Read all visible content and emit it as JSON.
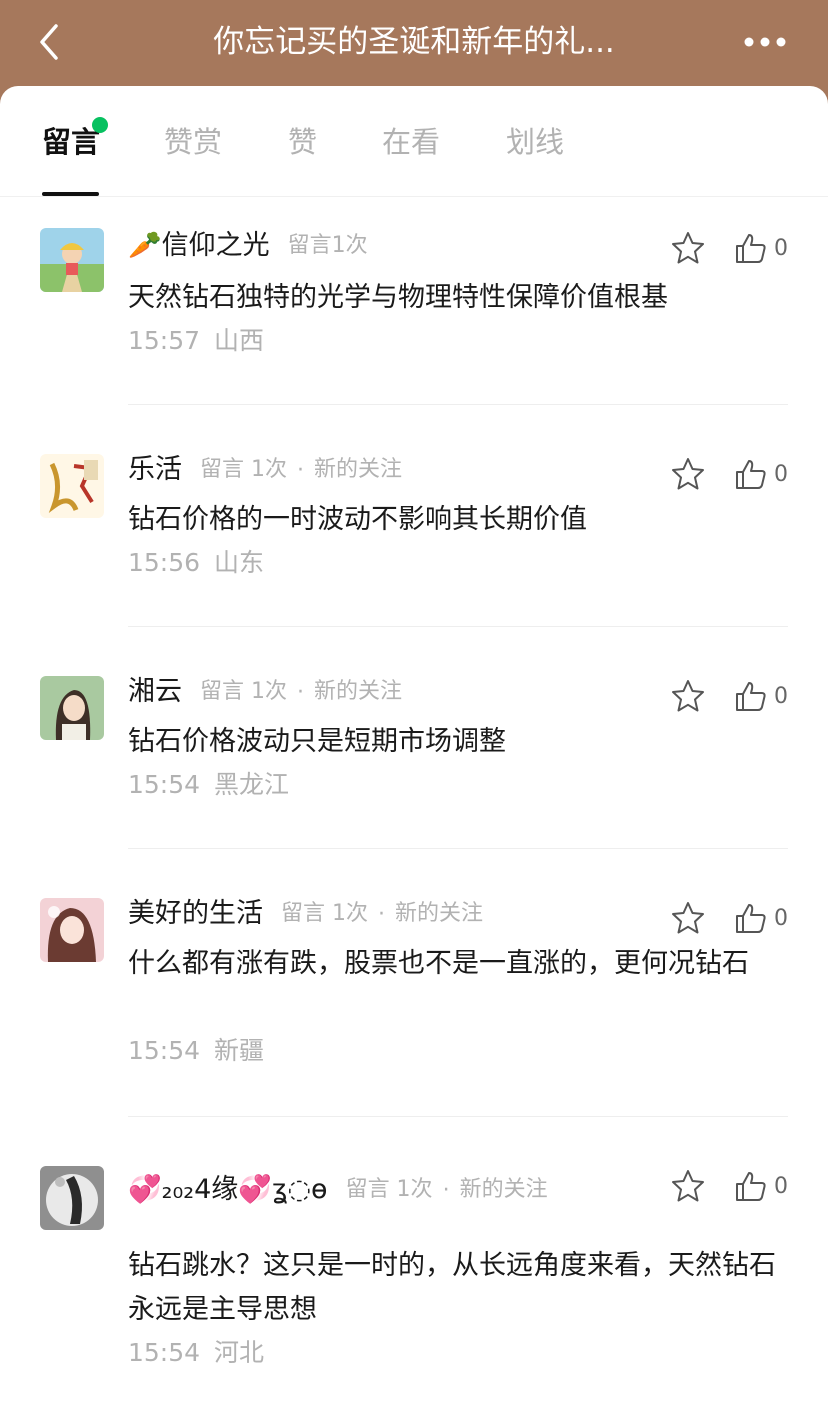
{
  "header": {
    "title": "你忘记买的圣诞和新年的礼...",
    "back_icon": "chevron-left-icon",
    "more_icon": "more-dots-icon"
  },
  "tabs": [
    {
      "label": "留言",
      "active": true
    },
    {
      "label": "赞赏",
      "active": false
    },
    {
      "label": "赞",
      "active": false
    },
    {
      "label": "在看",
      "active": false
    },
    {
      "label": "划线",
      "active": false
    }
  ],
  "colors": {
    "header_bg": "#a6785c",
    "unread_dot": "#07c160",
    "muted_text": "#b2b2b2"
  },
  "comments": [
    {
      "nickname": "🥕信仰之光",
      "count": "留言1次",
      "follow": "",
      "content": "天然钻石独特的光学与物理特性保障价值根基",
      "time": "15:57",
      "location": "山西",
      "likes": "0"
    },
    {
      "nickname": "乐活",
      "count": "留言 1次",
      "follow": "新的关注",
      "content": "钻石价格的一时波动不影响其长期价值",
      "time": "15:56",
      "location": "山东",
      "likes": "0"
    },
    {
      "nickname": "湘云",
      "count": "留言 1次",
      "follow": "新的关注",
      "content": "钻石价格波动只是短期市场调整",
      "time": "15:54",
      "location": "黑龙江",
      "likes": "0"
    },
    {
      "nickname": "美好的生活",
      "count": "留言 1次",
      "follow": "新的关注",
      "content": "什么都有涨有跌，股票也不是一直涨的，更何况钻石",
      "time": "15:54",
      "location": "新疆",
      "likes": "0"
    },
    {
      "nickname": "💞₂₀₂4缘💞ʓ◌ɵ",
      "count": "留言 1次",
      "follow": "新的关注",
      "content": "钻石跳水？这只是一时的，从长远角度来看，天然钻石永远是主导思想",
      "time": "15:54",
      "location": "河北",
      "likes": "0"
    }
  ]
}
